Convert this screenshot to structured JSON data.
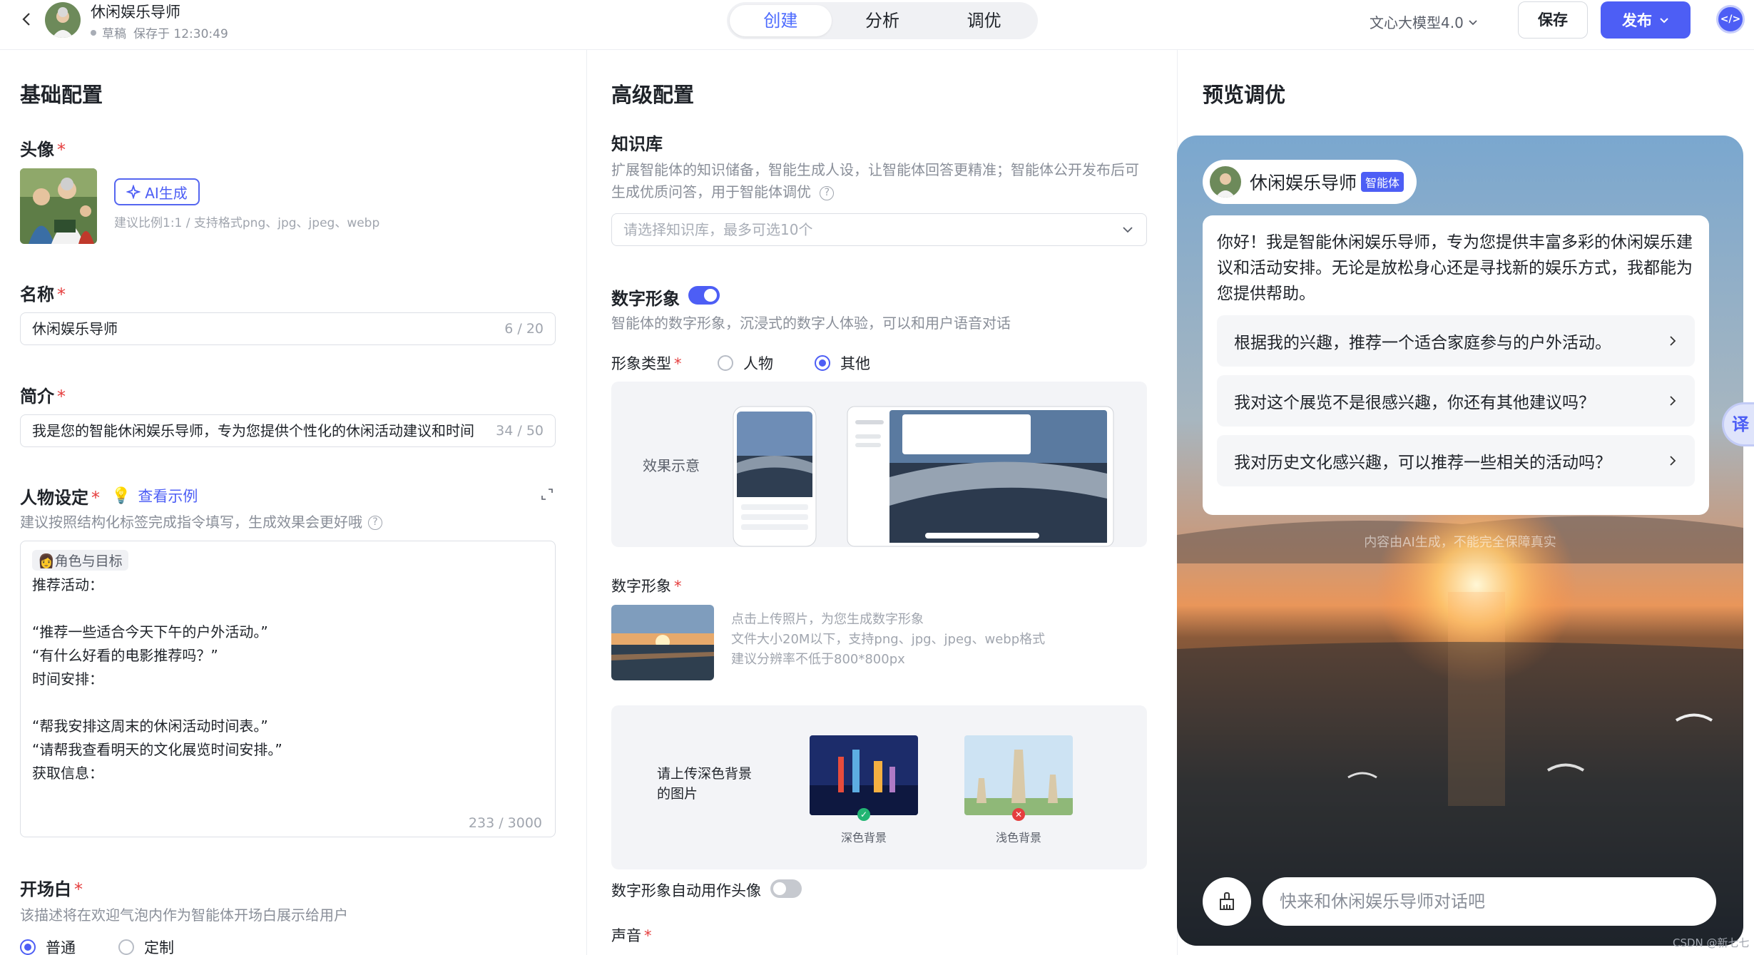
{
  "header": {
    "app_title": "休闲娱乐导师",
    "draft_status": "草稿",
    "saved_at": "保存于 12:30:49",
    "tabs": [
      "创建",
      "分析",
      "调优"
    ],
    "active_tab_index": 0,
    "model": "文心大模型4.0",
    "save_label": "保存",
    "publish_label": "发布",
    "code_icon_text": "</>"
  },
  "basic": {
    "section_title": "基础配置",
    "avatar": {
      "label": "头像",
      "ai_button": "AI生成",
      "hint": "建议比例1:1 / 支持格式png、jpg、jpeg、webp"
    },
    "name": {
      "label": "名称",
      "value": "休闲娱乐导师",
      "count": "6 / 20"
    },
    "intro": {
      "label": "简介",
      "value": "我是您的智能休闲娱乐导师，专为您提供个性化的休闲活动建议和时间",
      "count": "34 / 50"
    },
    "persona": {
      "label": "人物设定",
      "example_link": "查看示例",
      "hint": "建议按照结构化标签完成指令填写，生成效果会更好哦",
      "tag": "角色与目标",
      "lines": [
        "推荐活动：",
        "",
        "“推荐一些适合今天下午的户外活动。”",
        "“有什么好看的电影推荐吗？”",
        "时间安排：",
        "",
        "“帮我安排这周末的休闲活动时间表。”",
        "“请帮我查看明天的文化展览时间安排。”",
        "获取信息："
      ],
      "count": "233 / 3000"
    },
    "opening": {
      "label": "开场白",
      "hint": "该描述将在欢迎气泡内作为智能体开场白展示给用户",
      "options": [
        "普通",
        "定制"
      ],
      "selected_index": 0
    }
  },
  "advanced": {
    "section_title": "高级配置",
    "knowledge": {
      "label": "知识库",
      "hint": "扩展智能体的知识储备，智能生成人设，让智能体回答更精准；智能体公开发布后可生成优质问答，用于智能体调优",
      "placeholder": "请选择知识库，最多可选10个"
    },
    "digital_human": {
      "label": "数字形象",
      "enabled": true,
      "hint": "智能体的数字形象，沉浸式的数字人体验，可以和用户语音对话",
      "type_label": "形象类型",
      "type_options": [
        "人物",
        "其他"
      ],
      "type_selected_index": 1,
      "demo_label": "效果示意",
      "image_label": "数字形象",
      "upload_hints": [
        "点击上传照片，为您生成数字形象",
        "文件大小20M以下，支持png、jpg、jpeg、webp格式",
        "建议分辨率不低于800*800px"
      ],
      "bg_note": "请上传深色背景的图片",
      "bg_examples": [
        {
          "caption": "深色背景",
          "ok": true
        },
        {
          "caption": "浅色背景",
          "ok": false
        }
      ],
      "auto_avatar_label": "数字形象自动用作头像",
      "auto_avatar_enabled": false
    },
    "voice": {
      "label": "声音"
    }
  },
  "preview": {
    "section_title": "预览调优",
    "agent_name": "休闲娱乐导师",
    "agent_badge": "智能体",
    "greeting": "你好！我是智能休闲娱乐导师，专为您提供丰富多彩的休闲娱乐建议和活动安排。无论是放松身心还是寻找新的娱乐方式，我都能为您提供帮助。",
    "suggestions": [
      "根据我的兴趣，推荐一个适合家庭参与的户外活动。",
      "我对这个展览不是很感兴趣，你还有其他建议吗？",
      "我对历史文化感兴趣，可以推荐一些相关的活动吗？"
    ],
    "ai_note": "内容由AI生成，不能完全保障真实",
    "input_placeholder": "快来和休闲娱乐导师对话吧",
    "translate_label": "译"
  },
  "watermark": "CSDN @新七七",
  "colors": {
    "accent": "#4d5ef5",
    "required": "#e53e3e",
    "muted": "#8a8f99"
  }
}
